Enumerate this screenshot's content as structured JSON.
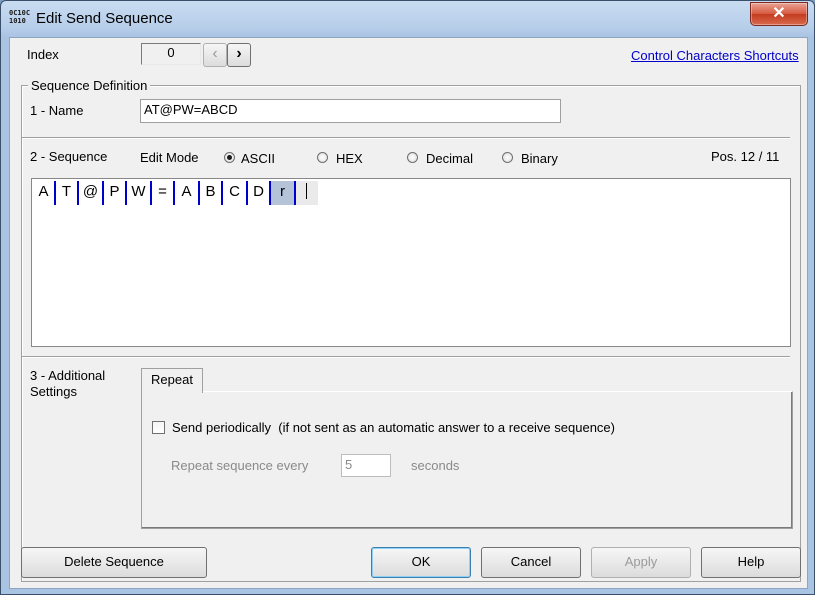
{
  "window": {
    "title": "Edit Send Sequence",
    "icon_text": [
      "0C10C",
      "1010"
    ],
    "close_glyph": "✕"
  },
  "index": {
    "label": "Index",
    "value": "0",
    "prev_glyph": "‹",
    "next_glyph": "›",
    "shortcuts_link": "Control Characters Shortcuts"
  },
  "definition": {
    "group_title": "Sequence Definition",
    "name_label": "1 - Name",
    "name_value": "AT@PW=ABCD"
  },
  "sequence": {
    "label": "2 - Sequence",
    "edit_mode_label": "Edit Mode",
    "modes": [
      {
        "label": "ASCII",
        "selected": true
      },
      {
        "label": "HEX",
        "selected": false
      },
      {
        "label": "Decimal",
        "selected": false
      },
      {
        "label": "Binary",
        "selected": false
      }
    ],
    "position": "Pos. 12 / 11",
    "chars": [
      "A",
      "T",
      "@",
      "P",
      "W",
      "=",
      "A",
      "B",
      "C",
      "D",
      "r"
    ],
    "highlighted_char_index": 10
  },
  "additional": {
    "label": "3 - Additional Settings",
    "tab_label": "Repeat",
    "send_periodically_label": "Send periodically",
    "send_periodically_note": "(if not sent as an automatic answer to a receive sequence)",
    "send_periodically_checked": false,
    "repeat_label": "Repeat sequence every",
    "repeat_value": "5",
    "repeat_unit": "seconds"
  },
  "buttons": {
    "delete": "Delete Sequence",
    "ok": "OK",
    "cancel": "Cancel",
    "apply": "Apply",
    "help": "Help"
  },
  "colors": {
    "cell_separator": "#0000cc",
    "highlight": "#b4c3d8",
    "link": "#0000cc"
  }
}
